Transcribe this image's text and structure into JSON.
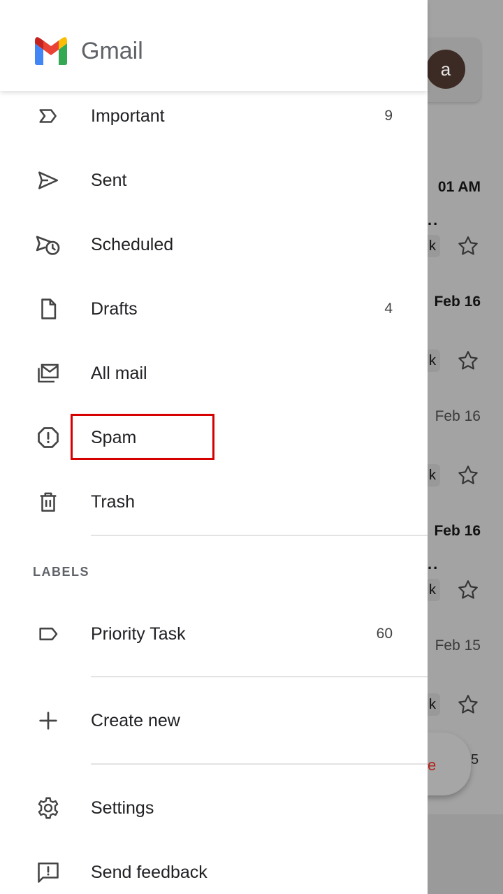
{
  "app": {
    "title": "Gmail"
  },
  "background": {
    "avatar_letter": "a",
    "times": [
      "01 AM",
      "Feb 16",
      "Feb 16",
      "Feb 16",
      "Feb 15"
    ],
    "chip_letter": "k",
    "dots": "..",
    "fab_label_fragment": "e",
    "fab_number_fragment": "5"
  },
  "drawer": {
    "folders": [
      {
        "label": "Important",
        "icon": "label-important-icon",
        "count": "9"
      },
      {
        "label": "Sent",
        "icon": "send-icon",
        "count": ""
      },
      {
        "label": "Scheduled",
        "icon": "schedule-send-icon",
        "count": ""
      },
      {
        "label": "Drafts",
        "icon": "draft-icon",
        "count": "4"
      },
      {
        "label": "All mail",
        "icon": "all-mail-icon",
        "count": ""
      },
      {
        "label": "Spam",
        "icon": "report-spam-icon",
        "count": ""
      },
      {
        "label": "Trash",
        "icon": "trash-icon",
        "count": ""
      }
    ],
    "labels_section_title": "LABELS",
    "labels": [
      {
        "label": "Priority Task",
        "icon": "label-icon",
        "count": "60"
      }
    ],
    "create_new_label": "Create new",
    "settings_label": "Settings",
    "feedback_label": "Send feedback"
  },
  "highlight": {
    "target": "Spam",
    "color": "#d50000"
  }
}
